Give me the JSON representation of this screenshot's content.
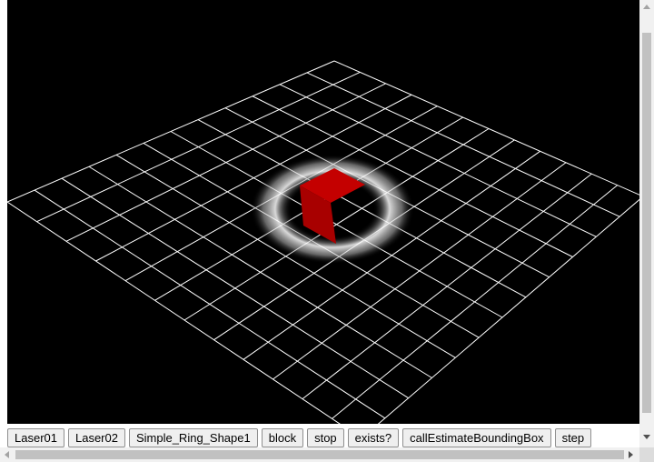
{
  "scene": {
    "background_color": "#000000",
    "grid_color": "#ffffff",
    "object_color": "#c40000",
    "ring_color": "#ffffff",
    "objects": [
      "grid-floor",
      "ring-glow",
      "red-block"
    ]
  },
  "toolbar": {
    "buttons": [
      {
        "label": "Laser01"
      },
      {
        "label": "Laser02"
      },
      {
        "label": "Simple_Ring_Shape1"
      },
      {
        "label": "block"
      },
      {
        "label": "stop"
      },
      {
        "label": "exists?"
      },
      {
        "label": "callEstimateBoundingBox"
      },
      {
        "label": "step"
      }
    ]
  },
  "scrollbars": {
    "vertical": "scrollbar",
    "horizontal": "scrollbar"
  }
}
